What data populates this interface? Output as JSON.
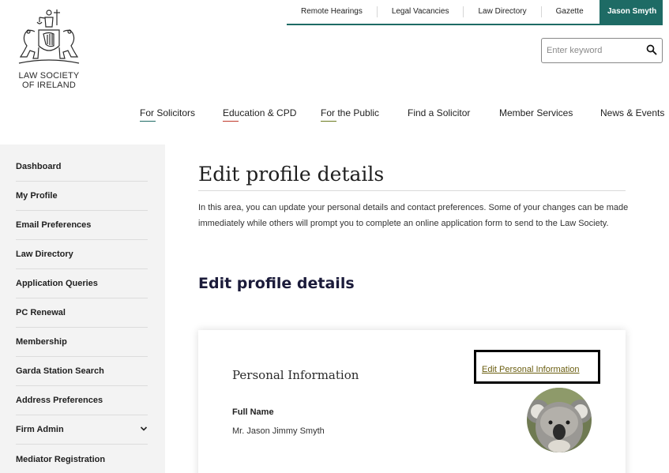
{
  "brand": {
    "logo_line1": "LAW SOCIETY",
    "logo_line2": "OF IRELAND",
    "accent": "#1e6b65"
  },
  "utility_nav": {
    "items": [
      "Remote Hearings",
      "Legal Vacancies",
      "Law Directory",
      "Gazette"
    ],
    "user": "Jason Smyth"
  },
  "search": {
    "placeholder": "Enter keyword",
    "value": "",
    "icon": "search-icon"
  },
  "main_nav": {
    "items": [
      {
        "label": "For Solicitors",
        "underline": "#1e6b65"
      },
      {
        "label": "Education & CPD",
        "underline": "#c0392b"
      },
      {
        "label": "For the Public",
        "underline": "#6b7a1f"
      },
      {
        "label": "Find a Solicitor",
        "underline": ""
      },
      {
        "label": "Member Services",
        "underline": ""
      },
      {
        "label": "News & Events",
        "underline": ""
      }
    ]
  },
  "sidebar": {
    "items": [
      {
        "label": "Dashboard"
      },
      {
        "label": "My Profile"
      },
      {
        "label": "Email Preferences"
      },
      {
        "label": "Law Directory"
      },
      {
        "label": "Application Queries"
      },
      {
        "label": "PC Renewal"
      },
      {
        "label": "Membership"
      },
      {
        "label": "Garda Station Search"
      },
      {
        "label": "Address Preferences"
      },
      {
        "label": "Firm Admin",
        "icon": "chevron-down-icon"
      },
      {
        "label": "Mediator Registration"
      }
    ]
  },
  "main": {
    "title": "Edit profile details",
    "intro": "In this area, you can update your personal details and contact preferences. Some of your changes can be made immediately while others will prompt you to complete an online application form to send to the Law Society.",
    "subtitle": "Edit profile details",
    "card": {
      "title": "Personal Information",
      "edit_link": "Edit Personal Information",
      "full_name_label": "Full Name",
      "full_name_value": "Mr. Jason Jimmy Smyth",
      "avatar_icon": "koala-avatar"
    }
  }
}
